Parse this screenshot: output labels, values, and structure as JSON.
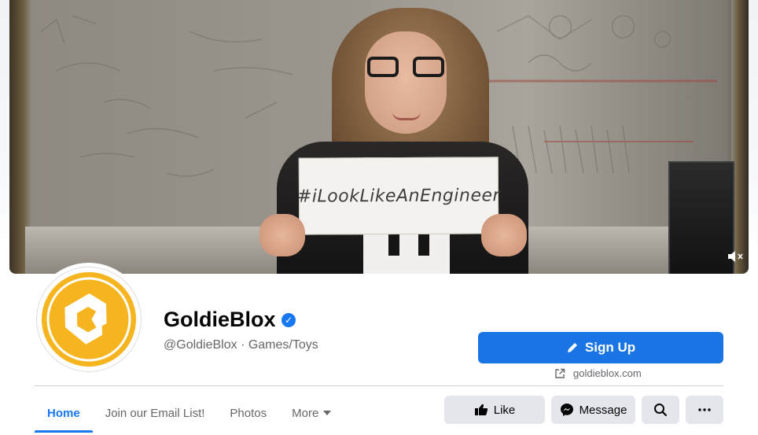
{
  "cover": {
    "sign_text": "#iLookLikeAnEngineer",
    "mute_icon": "speaker-muted-icon"
  },
  "profile": {
    "name": "GoldieBlox",
    "verified_icon": "verified-badge-icon",
    "handle": "@GoldieBlox · Games/Toys",
    "logo_color": "#f6b51e"
  },
  "cta": {
    "signup_label": "Sign Up",
    "signup_icon": "pencil-icon",
    "website": "goldieblox.com",
    "website_icon": "external-link-icon",
    "accent": "#1b74e4"
  },
  "tabs": [
    {
      "label": "Home",
      "active": true
    },
    {
      "label": "Join our Email List!",
      "active": false
    },
    {
      "label": "Photos",
      "active": false
    },
    {
      "label": "More",
      "active": false
    }
  ],
  "actions": {
    "like_label": "Like",
    "message_label": "Message",
    "search_icon": "search-icon",
    "more_icon": "more-dots-icon"
  }
}
